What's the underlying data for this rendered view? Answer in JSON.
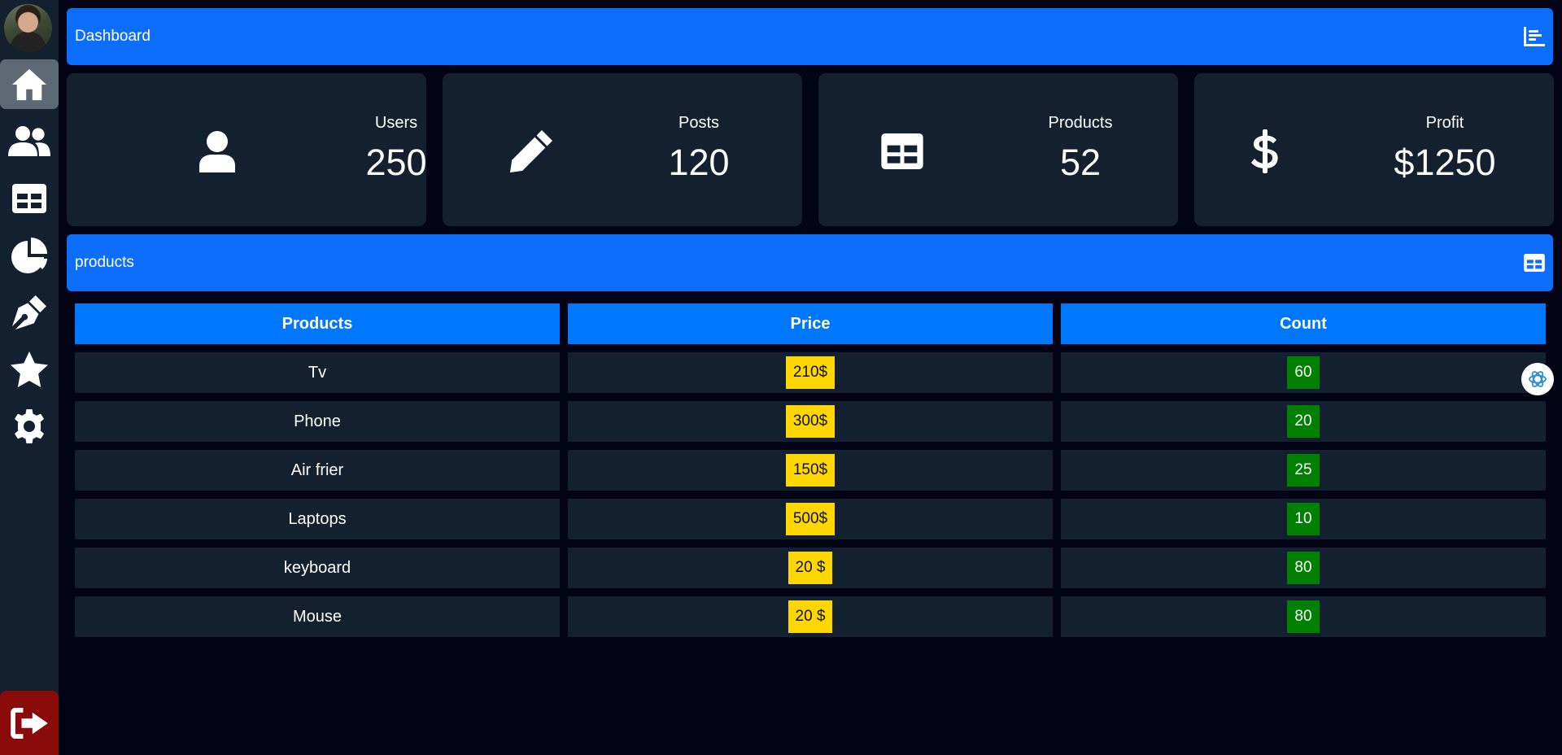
{
  "header": {
    "title": "Dashboard",
    "icon": "bar-chart-icon"
  },
  "sidebar": {
    "items": [
      {
        "name": "home",
        "icon": "home-icon",
        "active": true
      },
      {
        "name": "users",
        "icon": "users-icon",
        "active": false
      },
      {
        "name": "tables",
        "icon": "table-icon",
        "active": false
      },
      {
        "name": "charts",
        "icon": "pie-chart-icon",
        "active": false
      },
      {
        "name": "posts",
        "icon": "pen-nib-icon",
        "active": false
      },
      {
        "name": "favorites",
        "icon": "star-icon",
        "active": false
      },
      {
        "name": "settings",
        "icon": "gear-icon",
        "active": false
      }
    ],
    "logout_icon": "logout-icon"
  },
  "stats": [
    {
      "label": "Users",
      "value": "250",
      "icon": "user-icon"
    },
    {
      "label": "Posts",
      "value": "120",
      "icon": "pencil-icon"
    },
    {
      "label": "Products",
      "value": "52",
      "icon": "table-icon"
    },
    {
      "label": "Profit",
      "value": "$1250",
      "icon": "dollar-icon"
    }
  ],
  "products_section": {
    "title": "products",
    "icon": "table-icon"
  },
  "table": {
    "headers": [
      "Products",
      "Price",
      "Count"
    ],
    "rows": [
      {
        "product": "Tv",
        "price": "210$",
        "count": "60"
      },
      {
        "product": "Phone",
        "price": "300$",
        "count": "20"
      },
      {
        "product": "Air frier",
        "price": "150$",
        "count": "25"
      },
      {
        "product": "Laptops",
        "price": "500$",
        "count": "10"
      },
      {
        "product": "keyboard",
        "price": "20 $",
        "count": "80"
      },
      {
        "product": "Mouse",
        "price": "20 $",
        "count": "80"
      }
    ]
  },
  "colors": {
    "background": "#020415",
    "panel": "#12202f",
    "accent": "#0d6efd",
    "table_header": "#0077ff",
    "price_badge": "#ffd700",
    "count_badge": "#008000",
    "logout": "#8b0a0a"
  }
}
